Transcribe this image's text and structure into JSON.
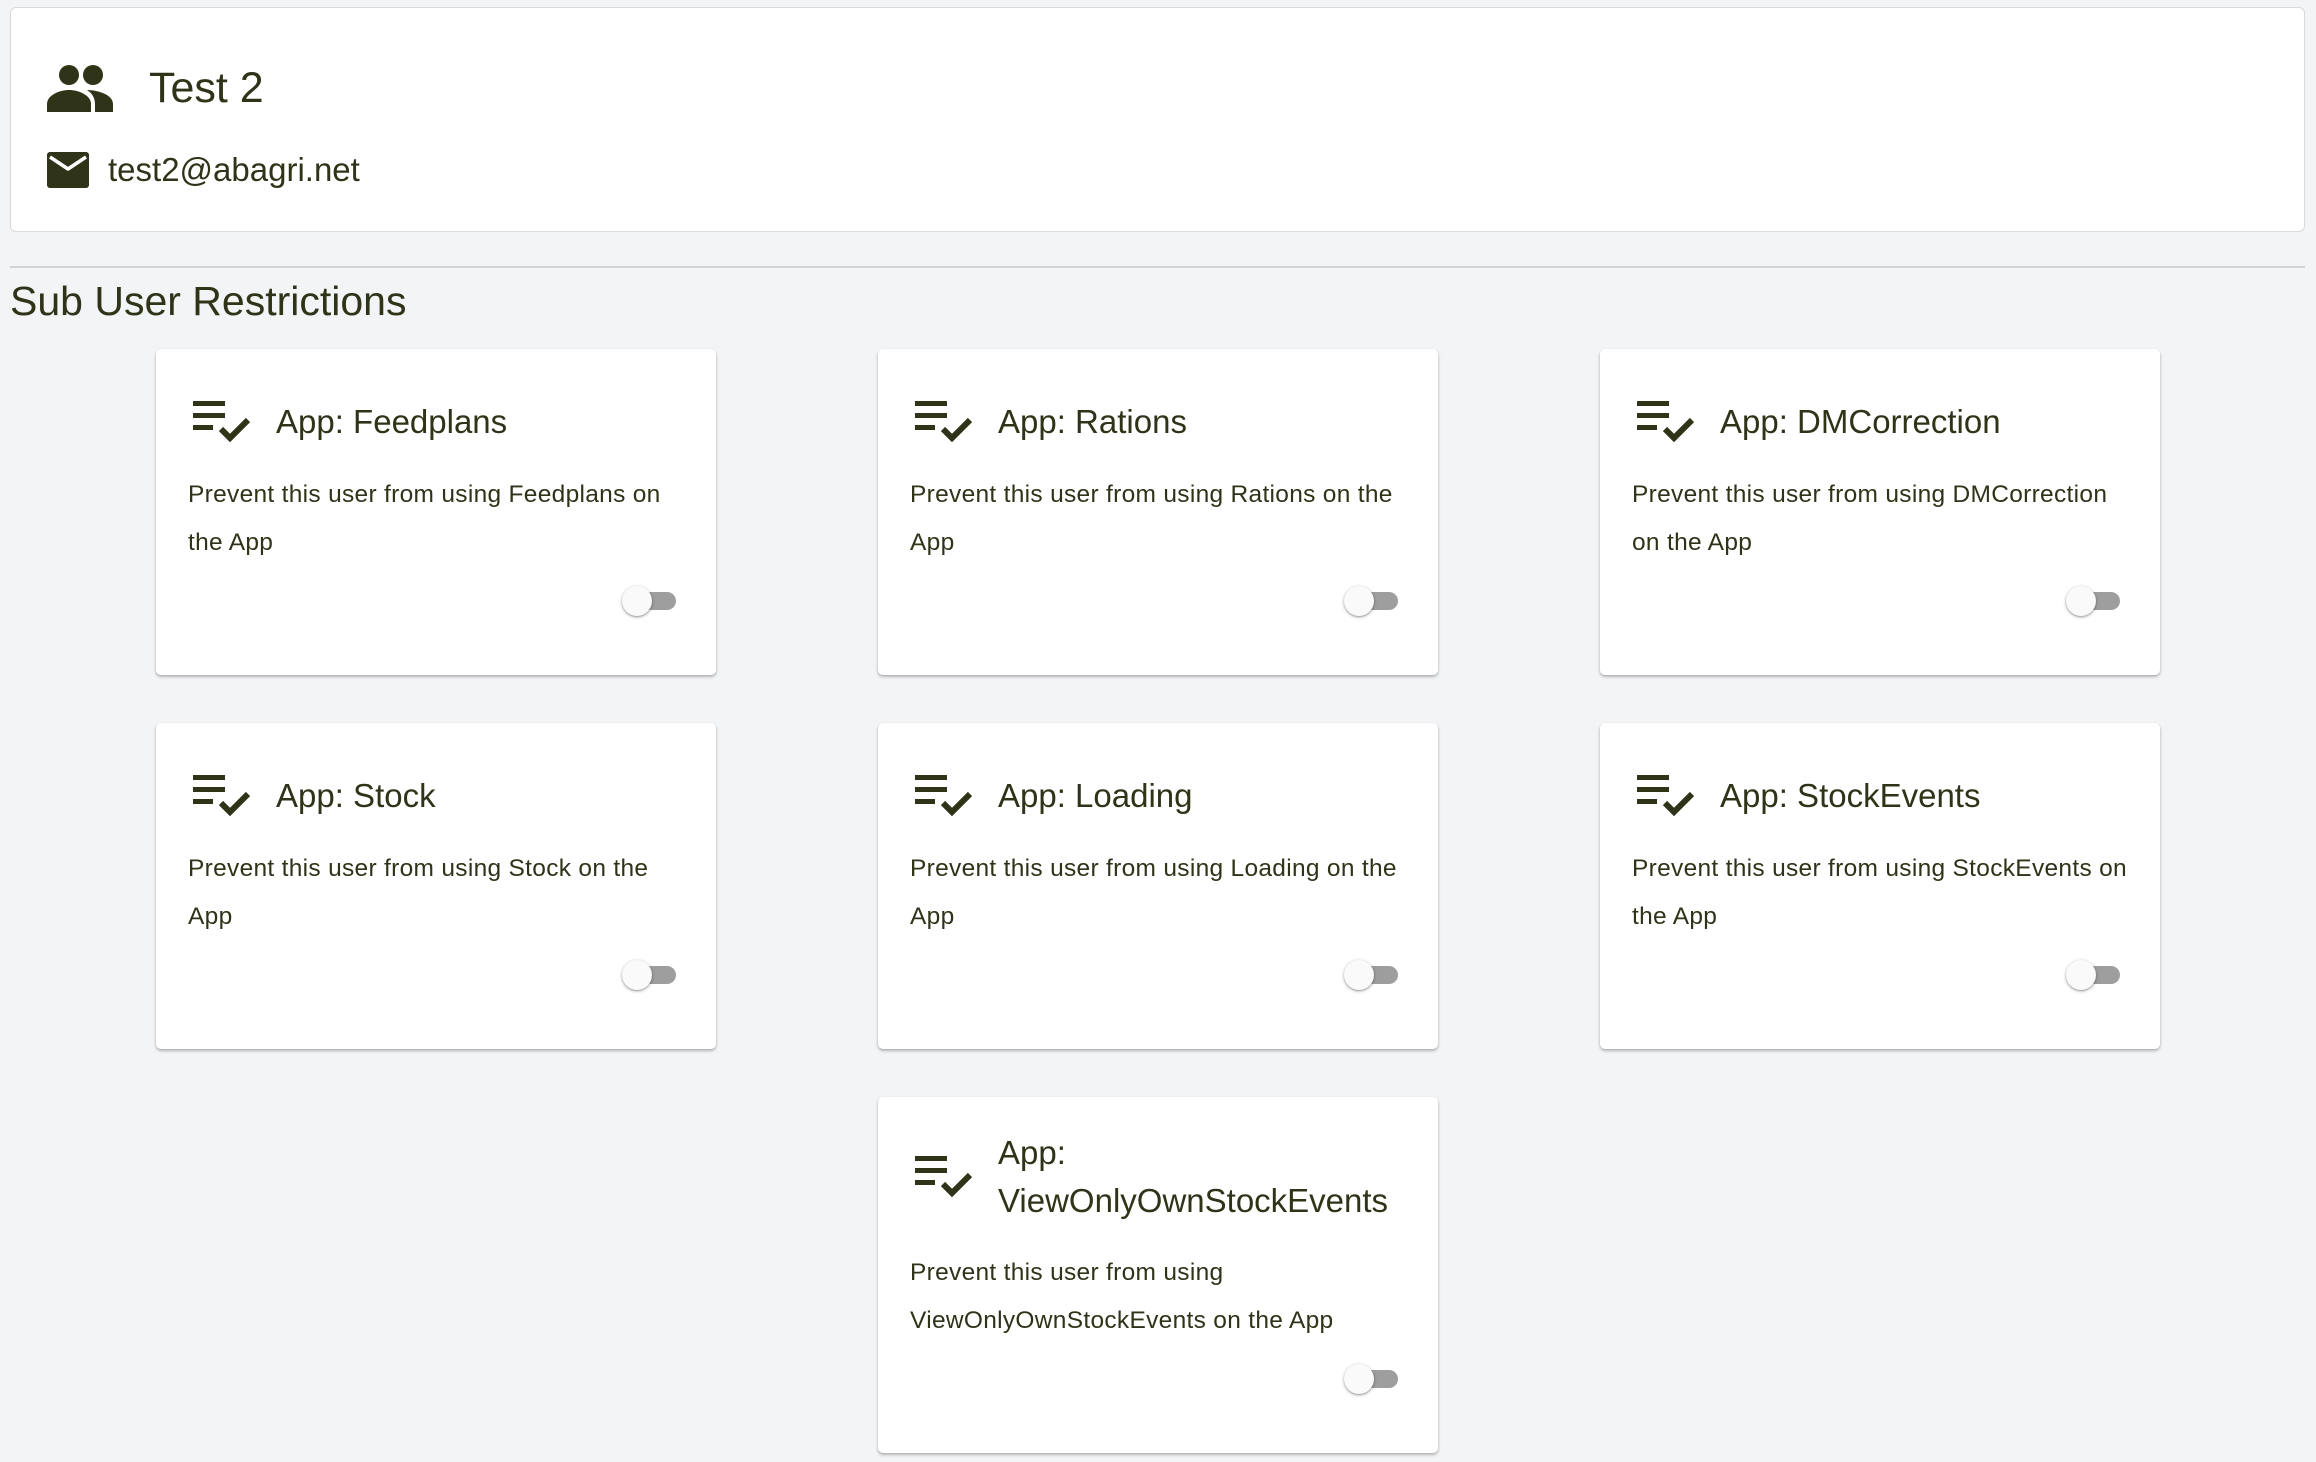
{
  "profile": {
    "name": "Test 2",
    "email": "test2@abagri.net",
    "name_icon": "group-icon",
    "email_icon": "mail-icon"
  },
  "section": {
    "title": "Sub User Restrictions"
  },
  "restrictions": [
    {
      "title": "App: Feedplans",
      "description": "Prevent this user from using Feedplans on the App",
      "enabled": false
    },
    {
      "title": "App: Rations",
      "description": "Prevent this user from using Rations on the App",
      "enabled": false
    },
    {
      "title": "App: DMCorrection",
      "description": "Prevent this user from using DMCorrection on the App",
      "enabled": false
    },
    {
      "title": "App: Stock",
      "description": "Prevent this user from using Stock on the App",
      "enabled": false
    },
    {
      "title": "App: Loading",
      "description": "Prevent this user from using Loading on the App",
      "enabled": false
    },
    {
      "title": "App: StockEvents",
      "description": "Prevent this user from using StockEvents on the App",
      "enabled": false
    },
    {
      "title": "App: ViewOnlyOwnStockEvents",
      "description": "Prevent this user from using ViewOnlyOwnStockEvents on the App",
      "enabled": false
    }
  ],
  "colors": {
    "text": "#2f3318",
    "background": "#f3f4f6",
    "toggle_off_track": "#9e9e9e",
    "toggle_off_thumb": "#fafafa"
  },
  "card_icon": "playlist-check-icon"
}
